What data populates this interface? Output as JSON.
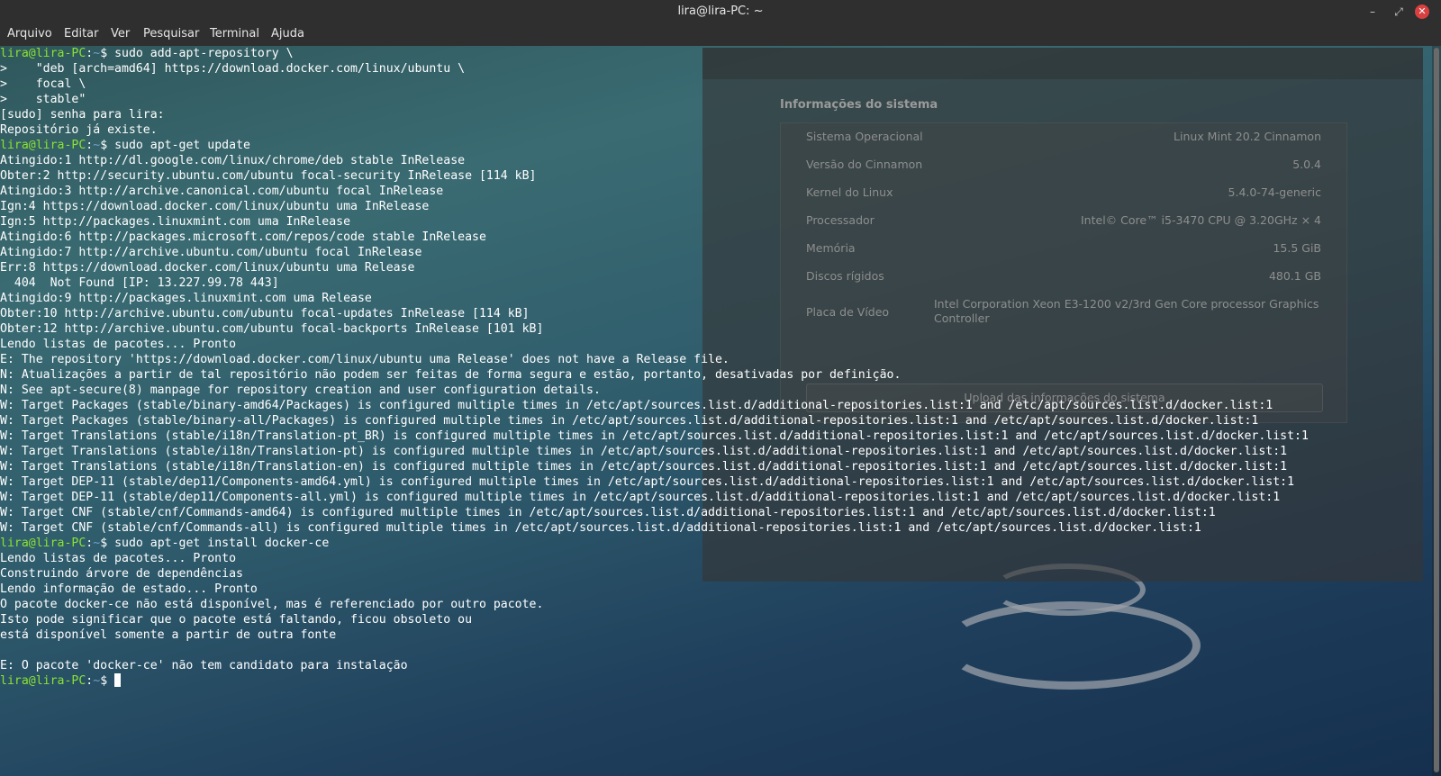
{
  "window": {
    "title": "lira@lira-PC: ~"
  },
  "menu": [
    "Arquivo",
    "Editar",
    "Ver",
    "Pesquisar",
    "Terminal",
    "Ajuda"
  ],
  "prompt": {
    "user_host": "lira@lira-PC",
    "path": "~",
    "symbol": "$"
  },
  "sysinfo": {
    "section_title": "Informações do sistema",
    "rows": [
      {
        "label": "Sistema Operacional",
        "value": "Linux Mint 20.2 Cinnamon"
      },
      {
        "label": "Versão do Cinnamon",
        "value": "5.0.4"
      },
      {
        "label": "Kernel do Linux",
        "value": "5.4.0-74-generic"
      },
      {
        "label": "Processador",
        "value": "Intel© Core™ i5-3470 CPU @ 3.20GHz × 4"
      },
      {
        "label": "Memória",
        "value": "15.5 GiB"
      },
      {
        "label": "Discos rígidos",
        "value": "480.1 GB"
      },
      {
        "label": "Placa de Vídeo",
        "value": "Intel Corporation Xeon E3-1200 v2/3rd Gen Core processor Graphics Controller"
      }
    ],
    "upload_button": "Upload das informações do sistema"
  },
  "terminal": {
    "lines": [
      {
        "cmd": "sudo add-apt-repository \\"
      },
      {
        "text": ">    \"deb [arch=amd64] https://download.docker.com/linux/ubuntu \\"
      },
      {
        "text": ">    focal \\"
      },
      {
        "text": ">    stable\""
      },
      {
        "text": "[sudo] senha para lira:"
      },
      {
        "text": "Repositório já existe."
      },
      {
        "cmd": "sudo apt-get update"
      },
      {
        "text": "Atingido:1 http://dl.google.com/linux/chrome/deb stable InRelease"
      },
      {
        "text": "Obter:2 http://security.ubuntu.com/ubuntu focal-security InRelease [114 kB]"
      },
      {
        "text": "Atingido:3 http://archive.canonical.com/ubuntu focal InRelease"
      },
      {
        "text": "Ign:4 https://download.docker.com/linux/ubuntu uma InRelease"
      },
      {
        "text": "Ign:5 http://packages.linuxmint.com uma InRelease"
      },
      {
        "text": "Atingido:6 http://packages.microsoft.com/repos/code stable InRelease"
      },
      {
        "text": "Atingido:7 http://archive.ubuntu.com/ubuntu focal InRelease"
      },
      {
        "text": "Err:8 https://download.docker.com/linux/ubuntu uma Release"
      },
      {
        "text": "  404  Not Found [IP: 13.227.99.78 443]"
      },
      {
        "text": "Atingido:9 http://packages.linuxmint.com uma Release"
      },
      {
        "text": "Obter:10 http://archive.ubuntu.com/ubuntu focal-updates InRelease [114 kB]"
      },
      {
        "text": "Obter:12 http://archive.ubuntu.com/ubuntu focal-backports InRelease [101 kB]"
      },
      {
        "text": "Lendo listas de pacotes... Pronto"
      },
      {
        "text": "E: The repository 'https://download.docker.com/linux/ubuntu uma Release' does not have a Release file."
      },
      {
        "text": "N: Atualizações a partir de tal repositório não podem ser feitas de forma segura e estão, portanto, desativadas por definição."
      },
      {
        "text": "N: See apt-secure(8) manpage for repository creation and user configuration details."
      },
      {
        "text": "W: Target Packages (stable/binary-amd64/Packages) is configured multiple times in /etc/apt/sources.list.d/additional-repositories.list:1 and /etc/apt/sources.list.d/docker.list:1"
      },
      {
        "text": "W: Target Packages (stable/binary-all/Packages) is configured multiple times in /etc/apt/sources.list.d/additional-repositories.list:1 and /etc/apt/sources.list.d/docker.list:1"
      },
      {
        "text": "W: Target Translations (stable/i18n/Translation-pt_BR) is configured multiple times in /etc/apt/sources.list.d/additional-repositories.list:1 and /etc/apt/sources.list.d/docker.list:1"
      },
      {
        "text": "W: Target Translations (stable/i18n/Translation-pt) is configured multiple times in /etc/apt/sources.list.d/additional-repositories.list:1 and /etc/apt/sources.list.d/docker.list:1"
      },
      {
        "text": "W: Target Translations (stable/i18n/Translation-en) is configured multiple times in /etc/apt/sources.list.d/additional-repositories.list:1 and /etc/apt/sources.list.d/docker.list:1"
      },
      {
        "text": "W: Target DEP-11 (stable/dep11/Components-amd64.yml) is configured multiple times in /etc/apt/sources.list.d/additional-repositories.list:1 and /etc/apt/sources.list.d/docker.list:1"
      },
      {
        "text": "W: Target DEP-11 (stable/dep11/Components-all.yml) is configured multiple times in /etc/apt/sources.list.d/additional-repositories.list:1 and /etc/apt/sources.list.d/docker.list:1"
      },
      {
        "text": "W: Target CNF (stable/cnf/Commands-amd64) is configured multiple times in /etc/apt/sources.list.d/additional-repositories.list:1 and /etc/apt/sources.list.d/docker.list:1"
      },
      {
        "text": "W: Target CNF (stable/cnf/Commands-all) is configured multiple times in /etc/apt/sources.list.d/additional-repositories.list:1 and /etc/apt/sources.list.d/docker.list:1"
      },
      {
        "cmd": "sudo apt-get install docker-ce"
      },
      {
        "text": "Lendo listas de pacotes... Pronto"
      },
      {
        "text": "Construindo árvore de dependências"
      },
      {
        "text": "Lendo informação de estado... Pronto"
      },
      {
        "text": "O pacote docker-ce não está disponível, mas é referenciado por outro pacote."
      },
      {
        "text": "Isto pode significar que o pacote está faltando, ficou obsoleto ou"
      },
      {
        "text": "está disponível somente a partir de outra fonte"
      },
      {
        "text": ""
      },
      {
        "text": "E: O pacote 'docker-ce' não tem candidato para instalação"
      },
      {
        "cmd": "",
        "cursor": true
      }
    ]
  },
  "colors": {
    "prompt_user": "#8ae234",
    "prompt_path": "#729fcf",
    "terminal_text": "#ffffff",
    "titlebar": "#2f2f2f",
    "close_button": "#d94040"
  }
}
